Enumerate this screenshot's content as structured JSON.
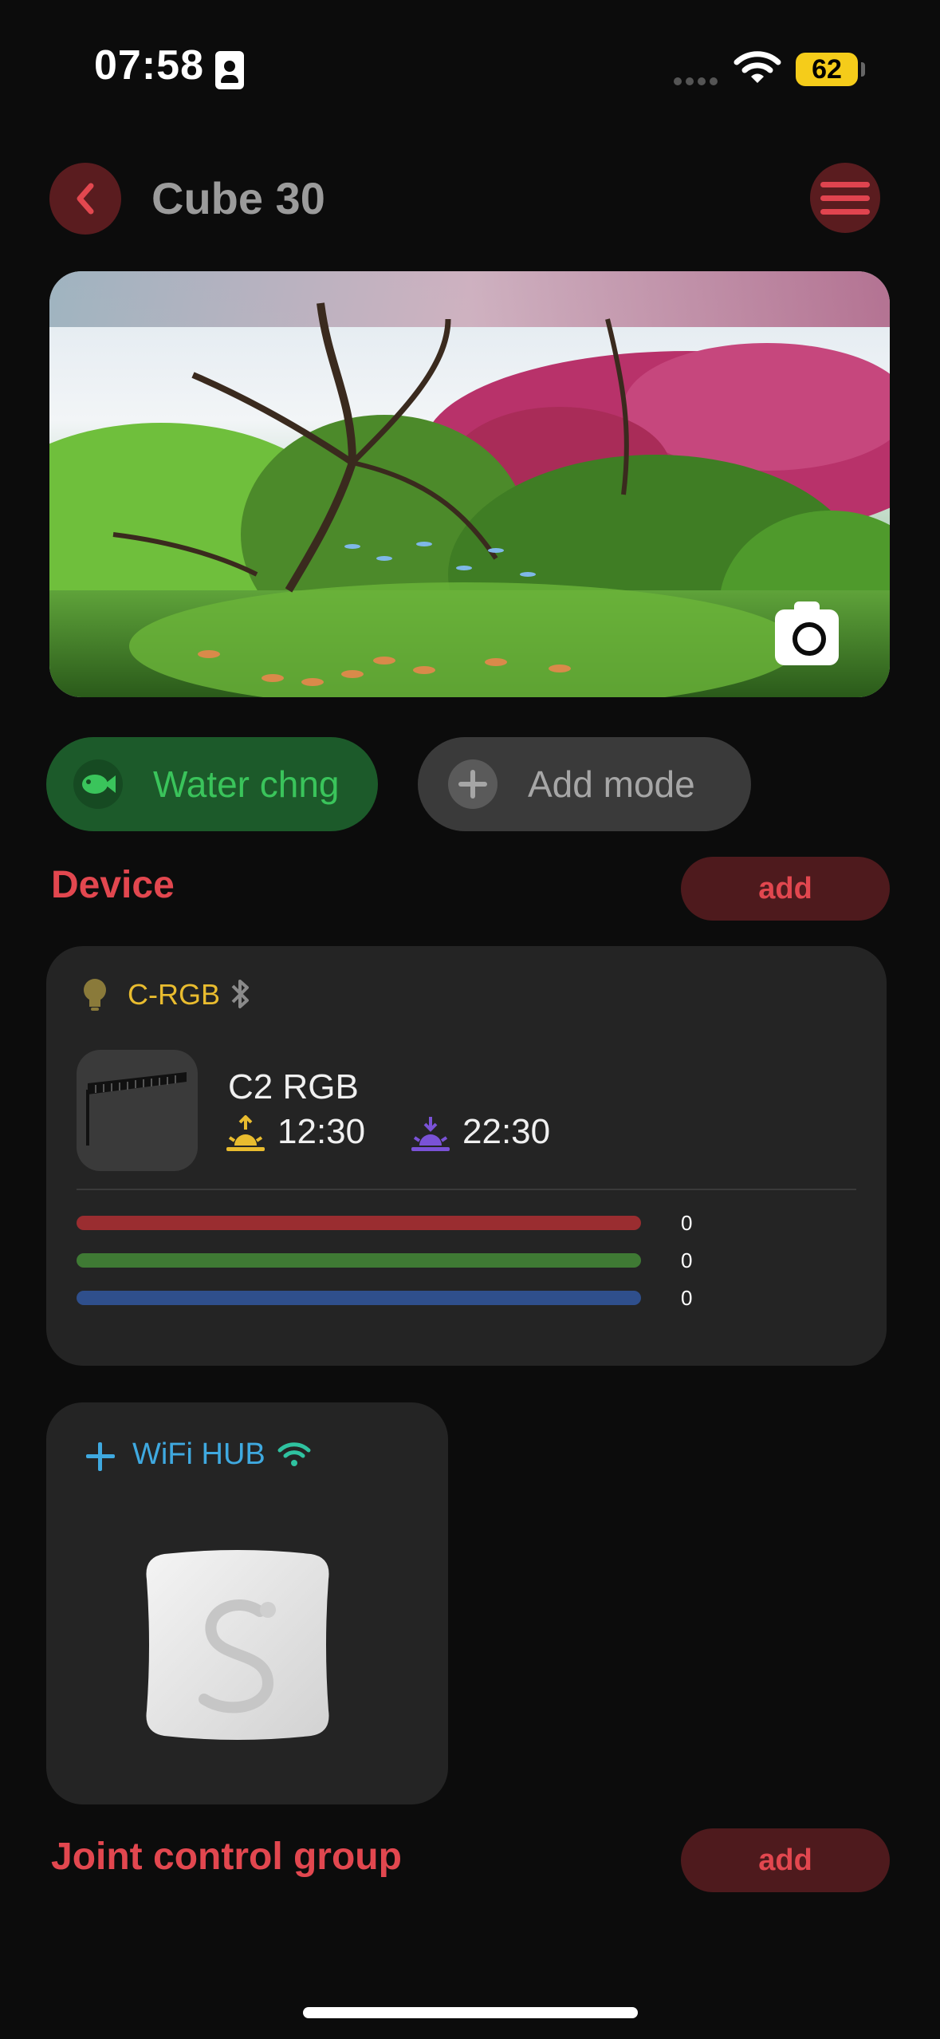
{
  "status_bar": {
    "time": "07:58",
    "battery": "62"
  },
  "header": {
    "title": "Cube 30"
  },
  "modes": [
    {
      "label": "Water chng",
      "icon": "fish-icon"
    },
    {
      "label": "Add mode",
      "icon": "plus-icon"
    }
  ],
  "device_section": {
    "title": "Device",
    "add_label": "add",
    "device": {
      "name": "C-RGB",
      "model": "C2 RGB",
      "sunrise": "12:30",
      "sunset": "22:30",
      "channels": [
        {
          "color": "#9a2d30",
          "value": "0"
        },
        {
          "color": "#3f7a34",
          "value": "0"
        },
        {
          "color": "#2f4f8c",
          "value": "0"
        }
      ]
    }
  },
  "hub": {
    "label": "WiFi HUB"
  },
  "joint_section": {
    "title": "Joint control group",
    "add_label": "add"
  },
  "colors": {
    "accent_red": "#e2474f",
    "green": "#3ac45b",
    "hub_blue": "#3fa9e0"
  }
}
